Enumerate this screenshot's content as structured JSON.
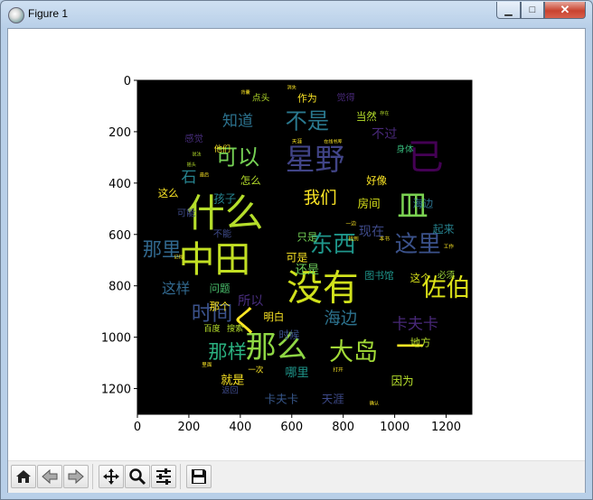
{
  "window": {
    "title": "Figure 1",
    "minimize_glyph": "▁",
    "maximize_glyph": "□",
    "close_glyph": "✕"
  },
  "toolbar": {
    "buttons": [
      {
        "name": "home-button",
        "icon": "home-icon"
      },
      {
        "name": "back-button",
        "icon": "back-arrow-icon"
      },
      {
        "name": "forward-button",
        "icon": "forward-arrow-icon"
      },
      {
        "name": "pan-button",
        "icon": "move-icon"
      },
      {
        "name": "zoom-button",
        "icon": "zoom-icon"
      },
      {
        "name": "configure-subplots-button",
        "icon": "sliders-icon"
      },
      {
        "name": "save-button",
        "icon": "floppy-disk-icon"
      }
    ]
  },
  "axes": {
    "x_ticks": [
      "0",
      "200",
      "400",
      "600",
      "800",
      "1000",
      "1200"
    ],
    "y_ticks": [
      "0",
      "200",
      "400",
      "600",
      "800",
      "1000",
      "1200"
    ],
    "xlim": [
      0,
      1300
    ],
    "ylim": [
      1300,
      0
    ],
    "background": "#000000"
  },
  "wordcloud": {
    "palette": [
      "#440154",
      "#46327e",
      "#365c8d",
      "#277f8e",
      "#1fa187",
      "#4ac16d",
      "#a0da39",
      "#fde725"
    ],
    "words": [
      {
        "t": "什么",
        "x": 340,
        "y": 520,
        "s": 150,
        "c": "#b5de2b"
      },
      {
        "t": "中田",
        "x": 300,
        "y": 700,
        "s": 140,
        "c": "#c2df23"
      },
      {
        "t": "没有",
        "x": 720,
        "y": 810,
        "s": 140,
        "c": "#d0e11c"
      },
      {
        "t": "那么",
        "x": 540,
        "y": 1040,
        "s": 120,
        "c": "#8fd744"
      },
      {
        "t": "星野",
        "x": 690,
        "y": 310,
        "s": 115,
        "c": "#414487"
      },
      {
        "t": "东西",
        "x": 760,
        "y": 640,
        "s": 90,
        "c": "#1f968b"
      },
      {
        "t": "这里",
        "x": 1090,
        "y": 640,
        "s": 90,
        "c": "#3b528b"
      },
      {
        "t": "佐伯",
        "x": 1200,
        "y": 810,
        "s": 95,
        "c": "#dde318"
      },
      {
        "t": "大岛",
        "x": 840,
        "y": 1060,
        "s": 95,
        "c": "#a2da37"
      },
      {
        "t": "不是",
        "x": 660,
        "y": 160,
        "s": 85,
        "c": "#2a788e"
      },
      {
        "t": "可以",
        "x": 390,
        "y": 300,
        "s": 85,
        "c": "#75d054"
      },
      {
        "t": "时间",
        "x": 290,
        "y": 910,
        "s": 80,
        "c": "#3b528b"
      },
      {
        "t": "那样",
        "x": 350,
        "y": 1060,
        "s": 75,
        "c": "#2ab07f"
      },
      {
        "t": "海边",
        "x": 790,
        "y": 930,
        "s": 65,
        "c": "#2c728e"
      },
      {
        "t": "卡夫卡",
        "x": 1080,
        "y": 950,
        "s": 60,
        "c": "#482878"
      },
      {
        "t": "我们",
        "x": 710,
        "y": 460,
        "s": 65,
        "c": "#fde725"
      },
      {
        "t": "知道",
        "x": 390,
        "y": 160,
        "s": 60,
        "c": "#2c728e"
      },
      {
        "t": "这样",
        "x": 150,
        "y": 810,
        "s": 55,
        "c": "#31688e"
      },
      {
        "t": "已",
        "x": 1120,
        "y": 300,
        "s": 140,
        "c": "#440154"
      },
      {
        "t": "皿",
        "x": 1070,
        "y": 490,
        "s": 120,
        "c": "#7ad151"
      },
      {
        "t": "く",
        "x": 420,
        "y": 940,
        "s": 120,
        "c": "#fde725"
      },
      {
        "t": "一",
        "x": 1060,
        "y": 1040,
        "s": 110,
        "c": "#fde725"
      },
      {
        "t": "那里",
        "x": 95,
        "y": 660,
        "s": 75,
        "c": "#31688e"
      },
      {
        "t": "石",
        "x": 200,
        "y": 380,
        "s": 60,
        "c": "#26828e"
      },
      {
        "t": "作为",
        "x": 660,
        "y": 70,
        "s": 38,
        "c": "#fde725"
      },
      {
        "t": "觉得",
        "x": 810,
        "y": 70,
        "s": 36,
        "c": "#482878"
      },
      {
        "t": "当然",
        "x": 890,
        "y": 140,
        "s": 40,
        "c": "#b5de2b"
      },
      {
        "t": "不过",
        "x": 960,
        "y": 210,
        "s": 50,
        "c": "#482878"
      },
      {
        "t": "身体",
        "x": 1040,
        "y": 270,
        "s": 34,
        "c": "#35b779"
      },
      {
        "t": "好像",
        "x": 930,
        "y": 390,
        "s": 40,
        "c": "#fde725"
      },
      {
        "t": "房间",
        "x": 900,
        "y": 480,
        "s": 44,
        "c": "#d8e219"
      },
      {
        "t": "海边",
        "x": 1110,
        "y": 480,
        "s": 40,
        "c": "#2c728e"
      },
      {
        "t": "现在",
        "x": 910,
        "y": 590,
        "s": 50,
        "c": "#3e4a89"
      },
      {
        "t": "起来",
        "x": 1190,
        "y": 580,
        "s": 42,
        "c": "#26828e"
      },
      {
        "t": "只是",
        "x": 660,
        "y": 610,
        "s": 40,
        "c": "#73d055"
      },
      {
        "t": "可是",
        "x": 620,
        "y": 690,
        "s": 42,
        "c": "#fde725"
      },
      {
        "t": "还是",
        "x": 660,
        "y": 740,
        "s": 46,
        "c": "#6ccd5a"
      },
      {
        "t": "图书馆",
        "x": 940,
        "y": 760,
        "s": 38,
        "c": "#1f968b"
      },
      {
        "t": "这个",
        "x": 1100,
        "y": 770,
        "s": 40,
        "c": "#d8e219"
      },
      {
        "t": "必须",
        "x": 1200,
        "y": 760,
        "s": 34,
        "c": "#9fda3a"
      },
      {
        "t": "问题",
        "x": 320,
        "y": 810,
        "s": 40,
        "c": "#4ac16d"
      },
      {
        "t": "所以",
        "x": 440,
        "y": 860,
        "s": 50,
        "c": "#472d7b"
      },
      {
        "t": "那个",
        "x": 320,
        "y": 880,
        "s": 40,
        "c": "#fde725"
      },
      {
        "t": "明白",
        "x": 530,
        "y": 920,
        "s": 40,
        "c": "#fde725"
      },
      {
        "t": "时候",
        "x": 590,
        "y": 990,
        "s": 40,
        "c": "#3b528b"
      },
      {
        "t": "地方",
        "x": 1100,
        "y": 1020,
        "s": 40,
        "c": "#b5de2b"
      },
      {
        "t": "百度",
        "x": 290,
        "y": 970,
        "s": 32,
        "c": "#b5de2b"
      },
      {
        "t": "搜索",
        "x": 380,
        "y": 970,
        "s": 32,
        "c": "#b5de2b"
      },
      {
        "t": "哪里",
        "x": 620,
        "y": 1140,
        "s": 46,
        "c": "#1f968b"
      },
      {
        "t": "就是",
        "x": 370,
        "y": 1170,
        "s": 46,
        "c": "#fde725"
      },
      {
        "t": "因为",
        "x": 1030,
        "y": 1170,
        "s": 44,
        "c": "#b5de2b"
      },
      {
        "t": "卡夫卡",
        "x": 560,
        "y": 1240,
        "s": 44,
        "c": "#38588c"
      },
      {
        "t": "天涯",
        "x": 760,
        "y": 1240,
        "s": 44,
        "c": "#3e4a89"
      },
      {
        "t": "他们",
        "x": 330,
        "y": 270,
        "s": 32,
        "c": "#fde725"
      },
      {
        "t": "感觉",
        "x": 220,
        "y": 230,
        "s": 36,
        "c": "#472d7b"
      },
      {
        "t": "怎么",
        "x": 440,
        "y": 390,
        "s": 40,
        "c": "#b5de2b"
      },
      {
        "t": "这么",
        "x": 120,
        "y": 440,
        "s": 40,
        "c": "#fde725"
      },
      {
        "t": "孩子",
        "x": 340,
        "y": 460,
        "s": 44,
        "c": "#26828e"
      },
      {
        "t": "可能",
        "x": 190,
        "y": 520,
        "s": 36,
        "c": "#3e4a89"
      },
      {
        "t": "不能",
        "x": 330,
        "y": 600,
        "s": 36,
        "c": "#3e4a89"
      },
      {
        "t": "返回",
        "x": 360,
        "y": 1210,
        "s": 32,
        "c": "#3e4a89"
      },
      {
        "t": "一次",
        "x": 460,
        "y": 1130,
        "s": 30,
        "c": "#fde725"
      },
      {
        "t": "点头",
        "x": 480,
        "y": 70,
        "s": 34,
        "c": "#b5de2b"
      },
      {
        "t": "在线书库",
        "x": 760,
        "y": 240,
        "s": 18,
        "c": "#fde725"
      },
      {
        "t": "天涯",
        "x": 620,
        "y": 240,
        "s": 20,
        "c": "#fde725"
      },
      {
        "t": "背囊",
        "x": 420,
        "y": 50,
        "s": 18,
        "c": "#fde725"
      },
      {
        "t": "工作",
        "x": 1210,
        "y": 650,
        "s": 20,
        "c": "#fde725"
      },
      {
        "t": "一边",
        "x": 830,
        "y": 560,
        "s": 20,
        "c": "#fde725"
      },
      {
        "t": "找到",
        "x": 840,
        "y": 620,
        "s": 20,
        "c": "#fde725"
      },
      {
        "t": "本书",
        "x": 960,
        "y": 620,
        "s": 20,
        "c": "#fde725"
      },
      {
        "t": "打开",
        "x": 780,
        "y": 1130,
        "s": 20,
        "c": "#fde725"
      },
      {
        "t": "里面",
        "x": 270,
        "y": 1110,
        "s": 20,
        "c": "#fde725"
      },
      {
        "t": "确认",
        "x": 920,
        "y": 1260,
        "s": 18,
        "c": "#fde725"
      },
      {
        "t": "消失",
        "x": 600,
        "y": 30,
        "s": 18,
        "c": "#fde725"
      },
      {
        "t": "存在",
        "x": 960,
        "y": 130,
        "s": 18,
        "c": "#b5de2b"
      },
      {
        "t": "说法",
        "x": 230,
        "y": 290,
        "s": 18,
        "c": "#b5de2b"
      },
      {
        "t": "摇头",
        "x": 210,
        "y": 330,
        "s": 18,
        "c": "#b5de2b"
      },
      {
        "t": "记得",
        "x": 160,
        "y": 690,
        "s": 18,
        "c": "#fde725"
      },
      {
        "t": "最后",
        "x": 260,
        "y": 370,
        "s": 18,
        "c": "#fde725"
      }
    ]
  }
}
